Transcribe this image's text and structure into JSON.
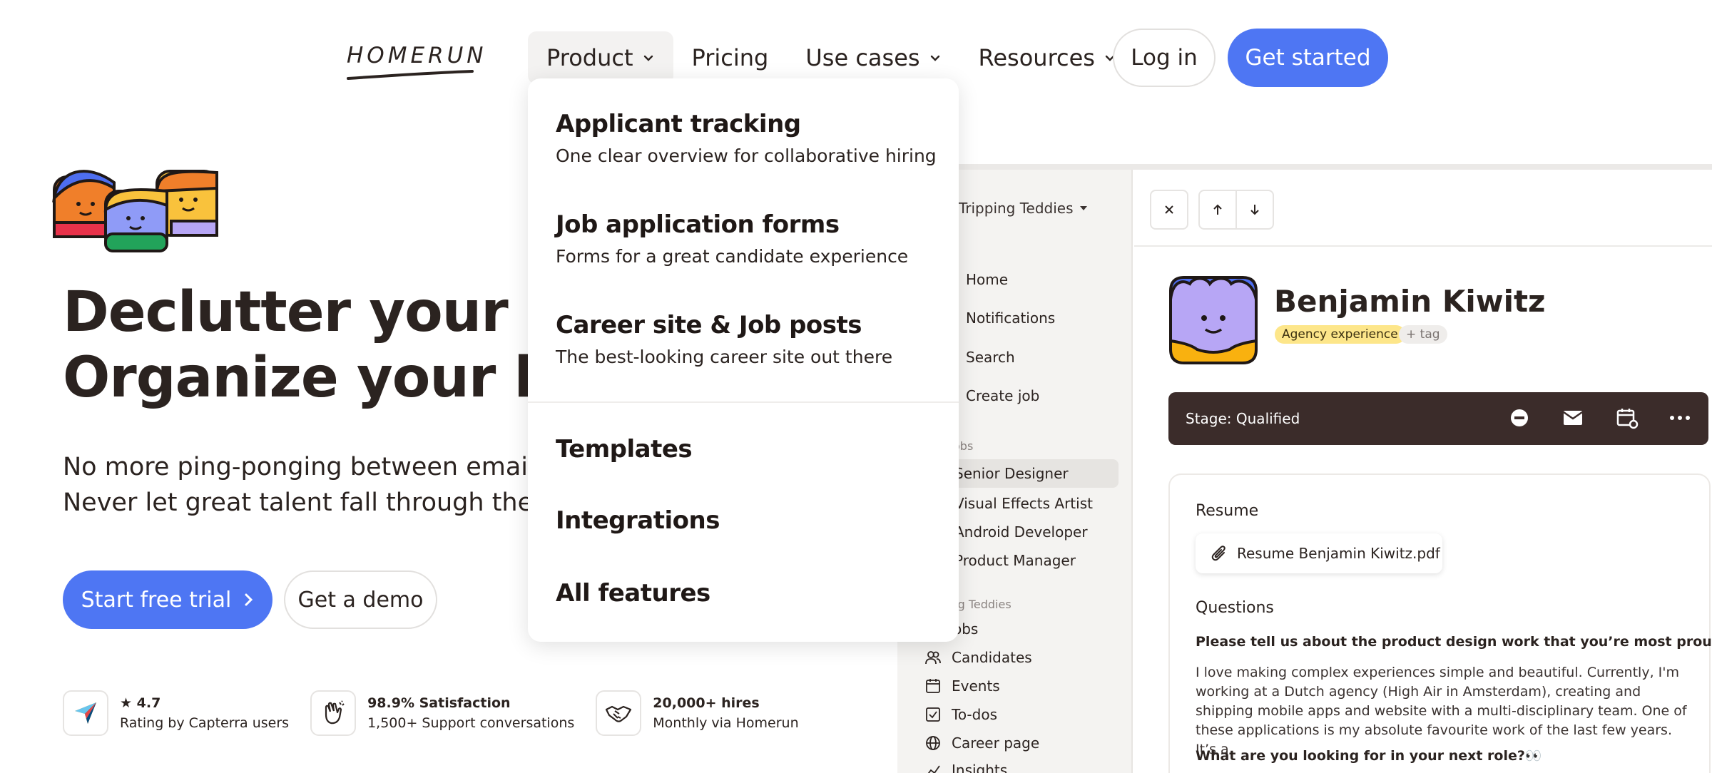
{
  "logo": {
    "text": "HOMERUN"
  },
  "nav": {
    "items": [
      {
        "label": "Product",
        "has_chevron": true,
        "active": true
      },
      {
        "label": "Pricing",
        "has_chevron": false
      },
      {
        "label": "Use cases",
        "has_chevron": true
      },
      {
        "label": "Resources",
        "has_chevron": true
      }
    ],
    "login": "Log in",
    "get_started": "Get started"
  },
  "dropdown": {
    "features": [
      {
        "title": "Applicant tracking",
        "desc": "One clear overview for collaborative hiring"
      },
      {
        "title": "Job application forms",
        "desc": "Forms for a great candidate experience"
      },
      {
        "title": "Career site & Job posts",
        "desc": "The best-looking career site out there"
      }
    ],
    "links": [
      "Templates",
      "Integrations",
      "All features"
    ]
  },
  "hero": {
    "title_line1": "Declutter your in",
    "title_line2": "Organize your hi",
    "sub_line1": "No more ping-ponging between emails, CV",
    "sub_line2": "Never let great talent fall through the crac",
    "trial_button": "Start free trial",
    "demo_button": "Get a demo"
  },
  "stats": [
    {
      "icon": "capterra-icon",
      "line1": "★ 4.7",
      "line2": "Rating by Capterra users"
    },
    {
      "icon": "clap-hands-icon",
      "line1": "98.9% Satisfaction",
      "line2": "1,500+ Support conversations"
    },
    {
      "icon": "handshake-icon",
      "line1": "20,000+ hires",
      "line2": "Monthly via Homerun"
    }
  ],
  "app": {
    "team": "Tripping Teddies",
    "sidebar_links": [
      "Home",
      "Notifications",
      "Search",
      "Create job"
    ],
    "jobs_section": "obs",
    "jobs": [
      "Senior Designer",
      "Visual Effects Artist",
      "Android Developer",
      "Product Manager"
    ],
    "team_section": "ing Teddies",
    "team_links": [
      {
        "icon": "jobs-icon",
        "label": "obs"
      },
      {
        "icon": "candidates-icon",
        "label": "Candidates"
      },
      {
        "icon": "calendar-icon",
        "label": "Events"
      },
      {
        "icon": "checkbox-icon",
        "label": "To-dos"
      },
      {
        "icon": "globe-icon",
        "label": "Career page"
      },
      {
        "icon": "chart-icon",
        "label": "Insights"
      }
    ],
    "candidate": {
      "name": "Benjamin Kiwitz",
      "tag": "Agency experience",
      "add_tag": "+ tag",
      "stage": "Stage: Qualified"
    },
    "resume": {
      "heading": "Resume",
      "file": "Resume Benjamin Kiwitz.pdf",
      "questions_heading": "Questions",
      "q1": "Please tell us about the product design work that you’re most proud of. 🙌",
      "a1": "I love making complex experiences simple and beautiful. Currently, I'm working at a Dutch agency (High Air in Amsterdam), creating and shipping mobile apps and website with a multi-disciplinary team. One of these applications is my absolute favourite work of the last few years. It’s a",
      "q2": "What are you looking for in your next role?👀"
    }
  }
}
